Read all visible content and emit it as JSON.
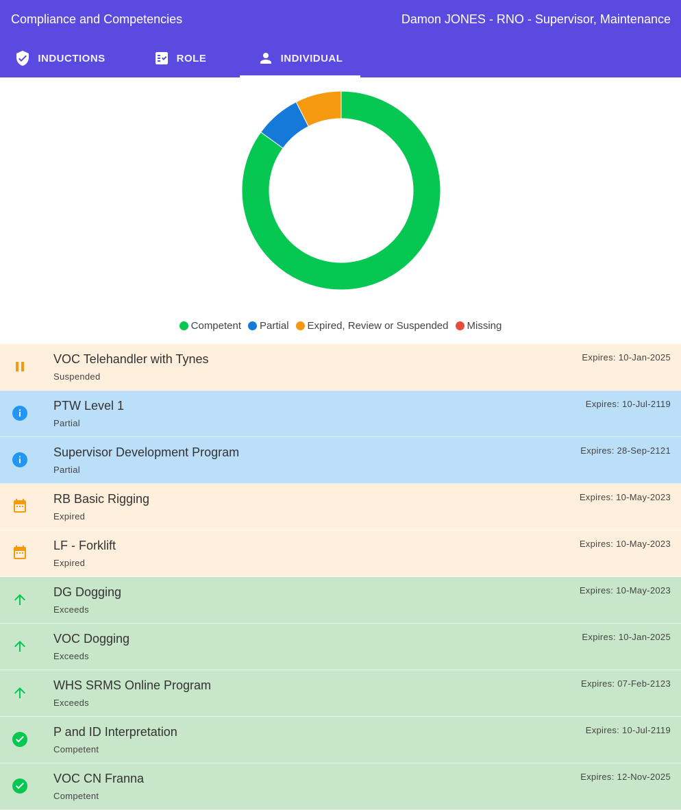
{
  "header": {
    "title": "Compliance and Competencies",
    "user": "Damon JONES - RNO - Supervisor, Maintenance"
  },
  "tabs": [
    {
      "label": "INDUCTIONS",
      "icon": "shield-check-icon"
    },
    {
      "label": "ROLE",
      "icon": "checklist-icon"
    },
    {
      "label": "INDIVIDUAL",
      "icon": "person-icon",
      "active": true
    }
  ],
  "chart_data": {
    "type": "pie",
    "categories": [
      "Competent",
      "Partial",
      "Expired, Review or Suspended",
      "Missing"
    ],
    "values": [
      85,
      7.5,
      7.5,
      0
    ],
    "colors": [
      "#05c752",
      "#1479d8",
      "#f59a0f",
      "#e94a3e"
    ],
    "legend": "bottom"
  },
  "items": [
    {
      "name": "VOC Telehandler with Tynes",
      "status": "Suspended",
      "expiry": "Expires: 10-Jan-2025",
      "kind": "suspended",
      "icon": "pause-icon"
    },
    {
      "name": "PTW Level 1",
      "status": "Partial",
      "expiry": "Expires: 10-Jul-2119",
      "kind": "partial",
      "icon": "info-icon"
    },
    {
      "name": "Supervisor Development Program",
      "status": "Partial",
      "expiry": "Expires: 28-Sep-2121",
      "kind": "partial",
      "icon": "info-icon"
    },
    {
      "name": "RB Basic Rigging",
      "status": "Expired",
      "expiry": "Expires: 10-May-2023",
      "kind": "expired",
      "icon": "calendar-icon"
    },
    {
      "name": "LF - Forklift",
      "status": "Expired",
      "expiry": "Expires: 10-May-2023",
      "kind": "expired",
      "icon": "calendar-icon"
    },
    {
      "name": "DG Dogging",
      "status": "Exceeds",
      "expiry": "Expires: 10-May-2023",
      "kind": "exceeds",
      "icon": "arrow-up-icon"
    },
    {
      "name": "VOC Dogging",
      "status": "Exceeds",
      "expiry": "Expires: 10-Jan-2025",
      "kind": "exceeds",
      "icon": "arrow-up-icon"
    },
    {
      "name": "WHS SRMS Online Program",
      "status": "Exceeds",
      "expiry": "Expires: 07-Feb-2123",
      "kind": "exceeds",
      "icon": "arrow-up-icon"
    },
    {
      "name": "P and ID Interpretation",
      "status": "Competent",
      "expiry": "Expires: 10-Jul-2119",
      "kind": "competent",
      "icon": "check-circle-icon"
    },
    {
      "name": "VOC CN Franna",
      "status": "Competent",
      "expiry": "Expires: 12-Nov-2025",
      "kind": "competent",
      "icon": "check-circle-icon"
    }
  ]
}
